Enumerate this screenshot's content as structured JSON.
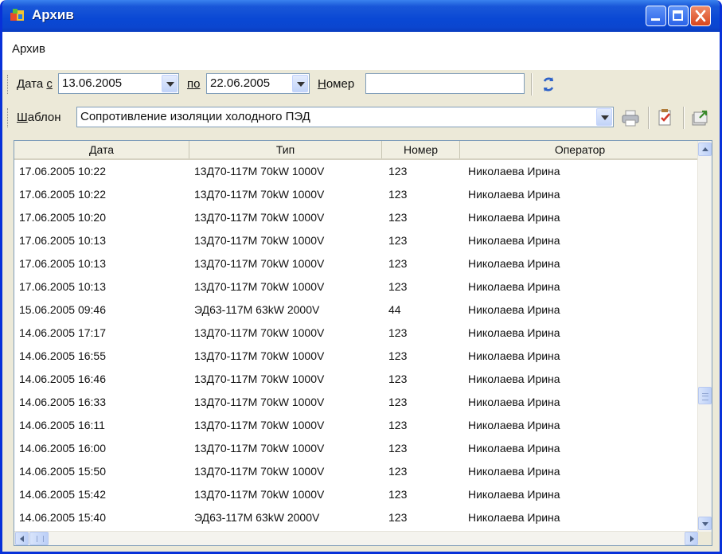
{
  "window": {
    "title": "Архив"
  },
  "menu": {
    "items": [
      "Архив"
    ]
  },
  "filter": {
    "date_from_label_prefix": "Дата ",
    "date_from_label_accel": "с",
    "date_from_value": "13.06.2005",
    "date_to_label_accel": "по",
    "date_to_value": "22.06.2005",
    "number_label_accel": "Н",
    "number_label_rest": "омер",
    "number_value": ""
  },
  "template": {
    "label_accel": "Ш",
    "label_rest": "аблон",
    "value": "Сопротивление изоляции холодного ПЭД"
  },
  "table": {
    "columns": [
      "Дата",
      "Тип",
      "Номер",
      "Оператор"
    ],
    "rows": [
      [
        "17.06.2005 10:22",
        "13Д70-117M 70kW 1000V",
        "123",
        "Николаева Ирина"
      ],
      [
        "17.06.2005 10:22",
        "13Д70-117M 70kW 1000V",
        "123",
        "Николаева Ирина"
      ],
      [
        "17.06.2005 10:20",
        "13Д70-117M 70kW 1000V",
        "123",
        "Николаева Ирина"
      ],
      [
        "17.06.2005 10:13",
        "13Д70-117M 70kW 1000V",
        "123",
        "Николаева Ирина"
      ],
      [
        "17.06.2005 10:13",
        "13Д70-117M 70kW 1000V",
        "123",
        "Николаева Ирина"
      ],
      [
        "17.06.2005 10:13",
        "13Д70-117M 70kW 1000V",
        "123",
        "Николаева Ирина"
      ],
      [
        "15.06.2005 09:46",
        "ЭД63-117M 63kW 2000V",
        "44",
        "Николаева Ирина"
      ],
      [
        "14.06.2005 17:17",
        "13Д70-117M 70kW 1000V",
        "123",
        "Николаева Ирина"
      ],
      [
        "14.06.2005 16:55",
        "13Д70-117M 70kW 1000V",
        "123",
        "Николаева Ирина"
      ],
      [
        "14.06.2005 16:46",
        "13Д70-117M 70kW 1000V",
        "123",
        "Николаева Ирина"
      ],
      [
        "14.06.2005 16:33",
        "13Д70-117M 70kW 1000V",
        "123",
        "Николаева Ирина"
      ],
      [
        "14.06.2005 16:11",
        "13Д70-117M 70kW 1000V",
        "123",
        "Николаева Ирина"
      ],
      [
        "14.06.2005 16:00",
        "13Д70-117M 70kW 1000V",
        "123",
        "Николаева Ирина"
      ],
      [
        "14.06.2005 15:50",
        "13Д70-117M 70kW 1000V",
        "123",
        "Николаева Ирина"
      ],
      [
        "14.06.2005 15:42",
        "13Д70-117M 70kW 1000V",
        "123",
        "Николаева Ирина"
      ],
      [
        "14.06.2005 15:40",
        "ЭД63-117M 63kW 2000V",
        "123",
        "Николаева Ирина"
      ]
    ]
  },
  "icons": {
    "app": "archive-app-icon",
    "refresh": "refresh-icon",
    "print": "printer-icon",
    "edit": "edit-report-icon",
    "export": "export-icon"
  },
  "colors": {
    "titlebar": "#0a48d4",
    "close_button": "#d8461d",
    "toolbar": "#ece9d8"
  }
}
